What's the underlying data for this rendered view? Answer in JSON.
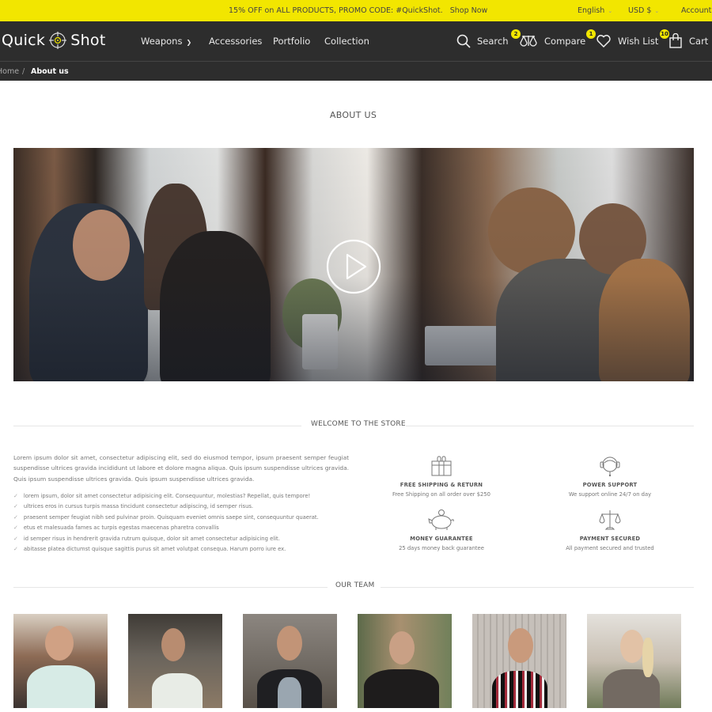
{
  "promo": {
    "text": "15% OFF on ALL PRODUCTS, PROMO CODE: #QuickShot.",
    "link": "Shop Now",
    "language": "English",
    "currency": "USD $",
    "account": "Account"
  },
  "header": {
    "logo_left": "Quick",
    "logo_right": "Shot",
    "nav": [
      {
        "label": "Weapons",
        "has_dropdown": true
      },
      {
        "label": "Accessories"
      },
      {
        "label": "Portfolio"
      },
      {
        "label": "Collection"
      }
    ],
    "actions": {
      "search": "Search",
      "compare": "Compare",
      "compare_count": "2",
      "wishlist": "Wish List",
      "wishlist_count": "1",
      "cart": "Cart",
      "cart_count": "10"
    },
    "accent_color": "#f2e600"
  },
  "breadcrumb": {
    "home": "Home",
    "separator": "/",
    "current": "About us"
  },
  "page": {
    "title": "ABOUT US",
    "hero_icon": "play-icon"
  },
  "welcome": {
    "heading": "WELCOME TO THE STORE",
    "intro": "Lorem ipsum dolor sit amet, consectetur adipiscing elit, sed do eiusmod tempor, ipsum praesent semper feugiat suspendisse ultrices gravida incididunt ut labore et dolore magna aliqua. Quis ipsum suspendisse ultrices gravida. Quis ipsum suspendisse ultrices gravida. Quis ipsum suspendisse ultrices gravida.",
    "checklist": [
      "lorem ipsum, dolor sit amet consectetur adipisicing elit. Consequuntur, molestias? Repellat, quis tempore!",
      "ultrices eros in cursus turpis massa tincidunt consectetur adipiscing, id semper risus.",
      "praesent semper feugiat nibh sed pulvinar proin. Quisquam eveniet omnis saepe sint, consequuntur quaerat.",
      "etus et malesuada fames ac turpis egestas maecenas pharetra convallis",
      "id semper risus in hendrerit gravida rutrum quisque, dolor sit amet consectetur adipisicing elit.",
      "abitasse platea dictumst quisque sagittis purus sit amet volutpat consequa. Harum porro iure ex."
    ],
    "features": [
      {
        "icon": "gift-icon",
        "title": "FREE SHIPPING & RETURN",
        "desc": "Free Shipping on all order over $250"
      },
      {
        "icon": "headset-support-icon",
        "title": "POWER SUPPORT",
        "desc": "We support online 24/7 on day"
      },
      {
        "icon": "piggy-bank-icon",
        "title": "MONEY GUARANTEE",
        "desc": "25 days money back guarantee"
      },
      {
        "icon": "scales-icon",
        "title": "PAYMENT SECURED",
        "desc": "All payment secured and trusted"
      }
    ]
  },
  "team": {
    "heading": "OUR TEAM",
    "members": [
      {
        "photo": "team-member-photo-1"
      },
      {
        "photo": "team-member-photo-2"
      },
      {
        "photo": "team-member-photo-3"
      },
      {
        "photo": "team-member-photo-4"
      },
      {
        "photo": "team-member-photo-5"
      },
      {
        "photo": "team-member-photo-6"
      }
    ]
  }
}
